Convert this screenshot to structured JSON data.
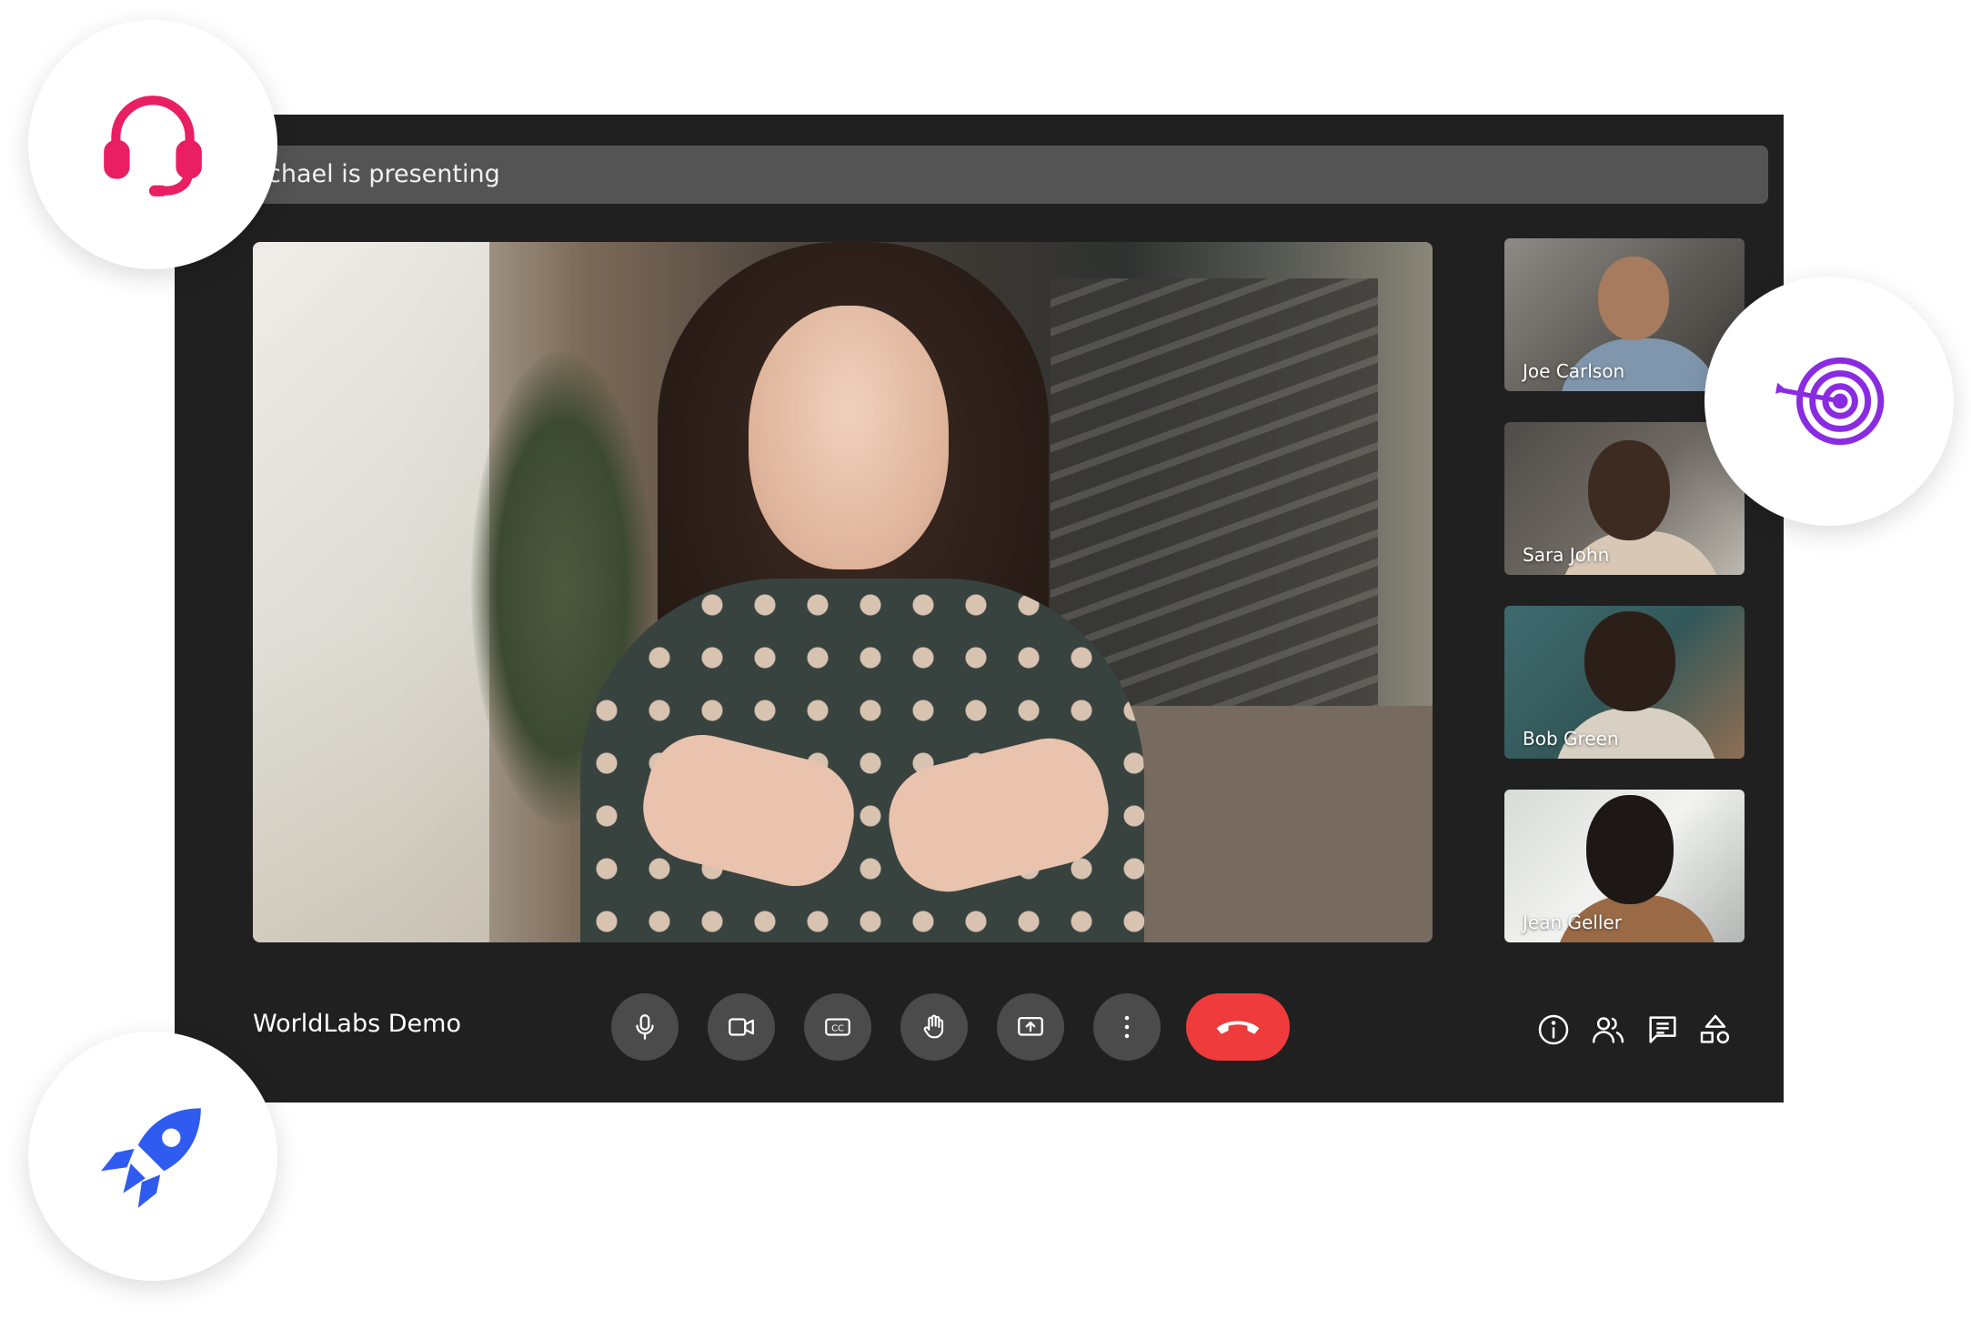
{
  "presenter_banner": "chael is presenting",
  "participants": [
    {
      "name": "Joe Carlson"
    },
    {
      "name": "Sara John"
    },
    {
      "name": "Bob Green"
    },
    {
      "name": "Jean Geller"
    }
  ],
  "meeting": {
    "title": "WorldLabs Demo"
  },
  "controls": [
    {
      "icon": "microphone-icon"
    },
    {
      "icon": "camera-icon"
    },
    {
      "icon": "captions-icon",
      "glyph": "CC"
    },
    {
      "icon": "raise-hand-icon"
    },
    {
      "icon": "share-screen-icon"
    },
    {
      "icon": "more-options-icon"
    },
    {
      "icon": "hang-up-icon"
    }
  ],
  "side_actions": [
    "info-icon",
    "people-icon",
    "chat-icon",
    "activities-icon"
  ],
  "badges": [
    "headset-icon",
    "target-icon",
    "rocket-icon"
  ],
  "colors": {
    "window_bg": "#202020",
    "banner_bg": "#545454",
    "control_bg": "#4b4b4b",
    "hangup": "#ef3b3b",
    "headset": "#e91e63",
    "target": "#8a2be2",
    "rocket": "#2f5bf0"
  }
}
